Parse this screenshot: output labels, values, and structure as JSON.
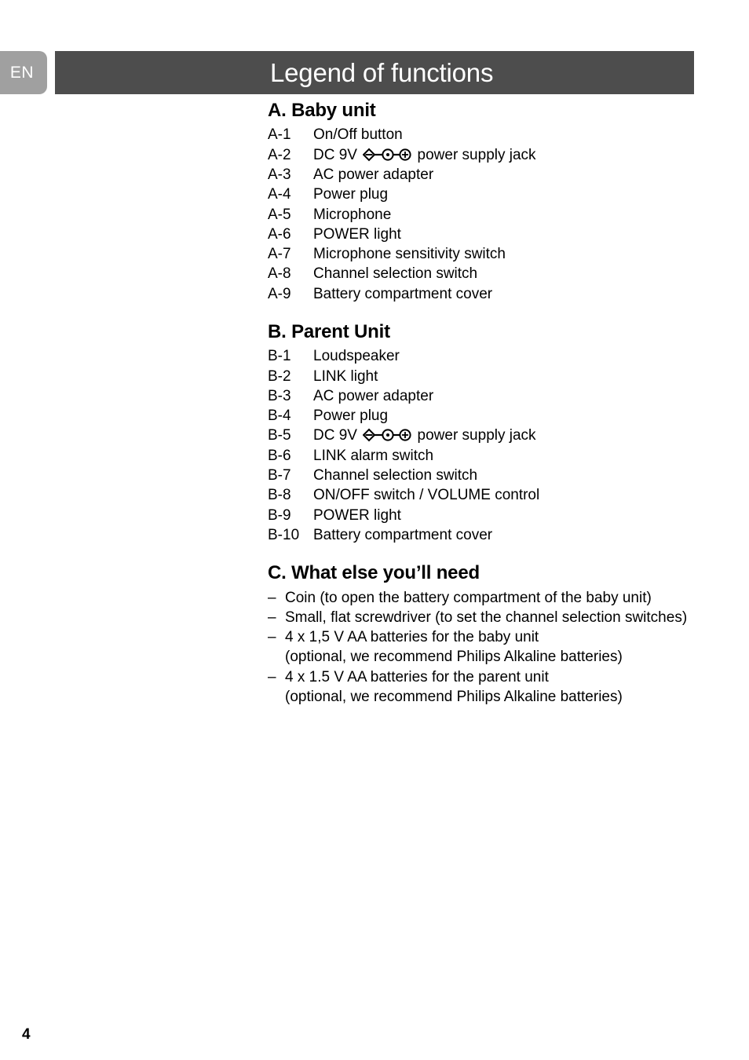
{
  "header": {
    "language_tab": "EN",
    "title": "Legend of functions",
    "bar_color": "#4d4d4d",
    "tab_color": "#a0a0a0"
  },
  "sections": [
    {
      "heading": "A. Baby unit",
      "kind": "labeled",
      "items": [
        {
          "label": "A-1",
          "text": "On/Off button",
          "symbol": null,
          "text_after": null
        },
        {
          "label": "A-2",
          "text": "DC 9V",
          "symbol": "dc-polarity-icon",
          "text_after": "power supply jack"
        },
        {
          "label": "A-3",
          "text": "AC power adapter",
          "symbol": null,
          "text_after": null
        },
        {
          "label": "A-4",
          "text": "Power plug",
          "symbol": null,
          "text_after": null
        },
        {
          "label": "A-5",
          "text": "Microphone",
          "symbol": null,
          "text_after": null
        },
        {
          "label": "A-6",
          "text": "POWER light",
          "symbol": null,
          "text_after": null
        },
        {
          "label": "A-7",
          "text": "Microphone sensitivity switch",
          "symbol": null,
          "text_after": null
        },
        {
          "label": "A-8",
          "text": "Channel selection switch",
          "symbol": null,
          "text_after": null
        },
        {
          "label": "A-9",
          "text": "Battery compartment cover",
          "symbol": null,
          "text_after": null
        }
      ]
    },
    {
      "heading": "B. Parent Unit",
      "kind": "labeled",
      "items": [
        {
          "label": "B-1",
          "text": "Loudspeaker",
          "symbol": null,
          "text_after": null
        },
        {
          "label": "B-2",
          "text": "LINK light",
          "symbol": null,
          "text_after": null
        },
        {
          "label": "B-3",
          "text": "AC power adapter",
          "symbol": null,
          "text_after": null
        },
        {
          "label": "B-4",
          "text": "Power plug",
          "symbol": null,
          "text_after": null
        },
        {
          "label": "B-5",
          "text": "DC 9V",
          "symbol": "dc-polarity-icon",
          "text_after": "power supply jack"
        },
        {
          "label": "B-6",
          "text": "LINK alarm switch",
          "symbol": null,
          "text_after": null
        },
        {
          "label": "B-7",
          "text": "Channel selection switch",
          "symbol": null,
          "text_after": null
        },
        {
          "label": "B-8",
          "text": "ON/OFF switch / VOLUME control",
          "symbol": null,
          "text_after": null
        },
        {
          "label": "B-9",
          "text": "POWER light",
          "symbol": null,
          "text_after": null
        },
        {
          "label": "B-10",
          "text": "Battery compartment cover",
          "symbol": null,
          "text_after": null
        }
      ]
    },
    {
      "heading": "C. What else you’ll need",
      "kind": "bulleted",
      "bullet_mark": "–",
      "items": [
        {
          "text": "Coin (to open the battery compartment of the baby unit)",
          "sub": null
        },
        {
          "text": "Small, flat screwdriver (to set the channel selection switches)",
          "sub": null
        },
        {
          "text": "4 x 1,5 V AA batteries for the baby unit",
          "sub": "(optional, we recommend Philips Alkaline batteries)"
        },
        {
          "text": "4 x 1.5 V AA batteries for the parent unit",
          "sub": "(optional, we recommend Philips Alkaline batteries)"
        }
      ]
    }
  ],
  "footer": {
    "page_number": "4"
  }
}
